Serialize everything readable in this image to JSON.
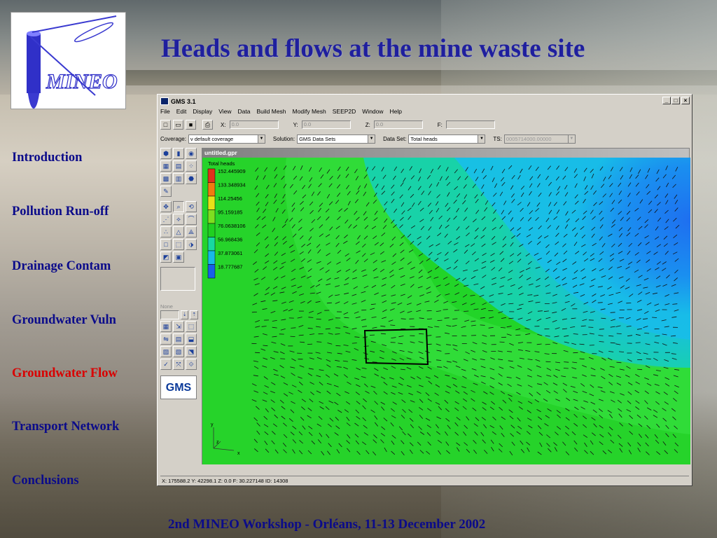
{
  "slide": {
    "title": "Heads and flows at the mine waste site",
    "footer": "2nd MINEO Workshop - Orléans, 11-13 December 2002",
    "logo_text": "MINEO",
    "nav": [
      {
        "label": "Introduction",
        "active": false
      },
      {
        "label": "Pollution Run-off",
        "active": false
      },
      {
        "label": "Drainage Contam",
        "active": false
      },
      {
        "label": "Groundwater Vuln",
        "active": false
      },
      {
        "label": "Groundwater Flow",
        "active": true
      },
      {
        "label": "Transport Network",
        "active": false
      },
      {
        "label": "Conclusions",
        "active": false
      }
    ],
    "colors": {
      "title": "#1f1f9e",
      "nav": "#0b0b8a",
      "nav_active": "#d90000"
    }
  },
  "app": {
    "title": "GMS 3.1",
    "window_buttons": [
      "_",
      "□",
      "×"
    ],
    "menu": [
      "File",
      "Edit",
      "Display",
      "View",
      "Data",
      "Build Mesh",
      "Modify Mesh",
      "SEEP2D",
      "Window",
      "Help"
    ],
    "toolbar": {
      "x_label": "X:",
      "x_value": "0.0",
      "y_label": "Y:",
      "y_value": "0.0",
      "z_label": "Z:",
      "z_value": "0.0",
      "f_label": "F:",
      "f_value": ""
    },
    "options": {
      "coverage_label": "Coverage:",
      "coverage_value": "v default coverage",
      "solution_label": "Solution:",
      "solution_value": "GMS Data Sets",
      "dataset_label": "Data Set:",
      "dataset_value": "Total heads",
      "ts_label": "TS:",
      "ts_value": "0005714000.00000"
    },
    "palette_none": "None",
    "gms_logo": "GMS",
    "document": {
      "title": "untitled.gpr",
      "legend_title": "Total heads",
      "legend": [
        {
          "value": "152.445909",
          "color": "#e0301c"
        },
        {
          "value": "133.348934",
          "color": "#f07a10"
        },
        {
          "value": "114.25456",
          "color": "#e8e018"
        },
        {
          "value": "95.159185",
          "color": "#7ede20"
        },
        {
          "value": "76.0638106",
          "color": "#20d020"
        },
        {
          "value": "56.968436",
          "color": "#18d8a0"
        },
        {
          "value": "37.873061",
          "color": "#18b8e8"
        },
        {
          "value": "18.777687",
          "color": "#1860e8"
        }
      ],
      "axis_y": "y",
      "axis_z": "z",
      "axis_x": "x"
    },
    "status": "X: 175588.2  Y: 42298.1  Z: 0.0  F: 30.227148  ID: 14308"
  }
}
